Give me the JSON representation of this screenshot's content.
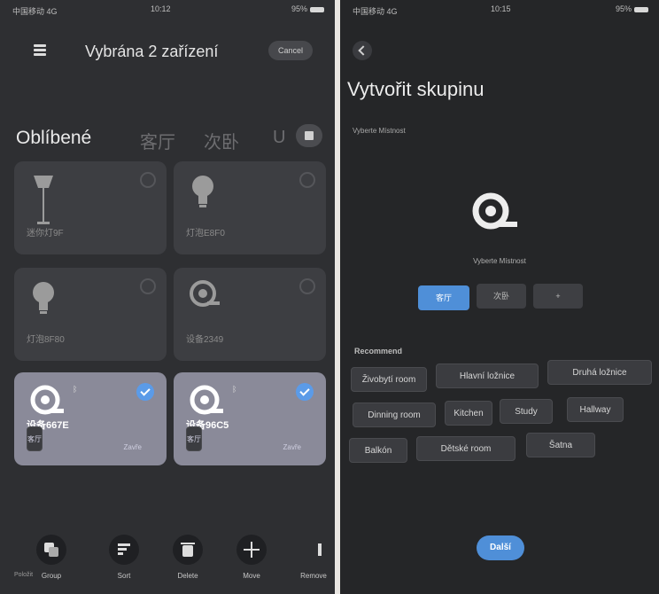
{
  "left": {
    "status": {
      "carrier": "中国移动 4G",
      "time": "10:12",
      "battery": "95%"
    },
    "title": "Vybrána 2 zařízení",
    "cancel": "Cancel",
    "tabs": {
      "active": "Oblíbené",
      "t1": "客厅",
      "t2": "次卧",
      "t3": "U"
    },
    "devices": [
      {
        "name": "迷你灯9F",
        "selected": false,
        "icon": "floor-lamp-icon"
      },
      {
        "name": "灯泡E8F0",
        "selected": false,
        "icon": "bulb-icon"
      },
      {
        "name": "灯泡8F80",
        "selected": false,
        "icon": "bulb-icon"
      },
      {
        "name": "设备2349",
        "selected": false,
        "icon": "strip-light-icon"
      },
      {
        "name": "设备667E",
        "room": "客厅",
        "state": "Zavře",
        "selected": true,
        "icon": "strip-light-icon"
      },
      {
        "name": "设备96C5",
        "room": "客厅",
        "state": "Zavře",
        "selected": true,
        "icon": "strip-light-icon"
      }
    ],
    "actions": {
      "group": "Group",
      "sort": "Sort",
      "delete": "Delete",
      "move": "Move",
      "remove": "Remove"
    },
    "watermark": "Položit"
  },
  "right": {
    "status": {
      "carrier": "中国移动 4G",
      "time": "10:15",
      "battery": "95%"
    },
    "title": "Vytvořit skupinu",
    "subtitle": "Vyberte Místnost",
    "caption": "Vyberte Místnost",
    "room_chips": [
      "客厅",
      "次卧",
      "+"
    ],
    "recommend": "Recommend",
    "rooms": [
      "Živobytí room",
      "Hlavní ložnice",
      "Druhá ložnice",
      "Dinning room",
      "Kitchen",
      "Study",
      "Hallway",
      "Balkón",
      "Dětské room",
      "Šatna"
    ],
    "next": "Další"
  },
  "colors": {
    "accent": "#4f8fd8",
    "selected_card": "#8a8a99"
  }
}
